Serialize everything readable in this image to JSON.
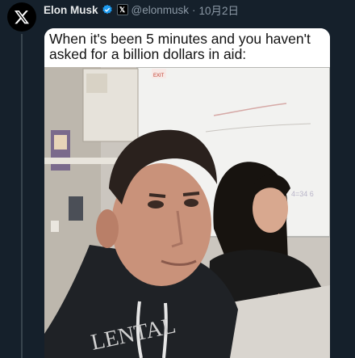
{
  "author": {
    "name": "Elon Musk",
    "handle": "@elonmusk",
    "separator": "·",
    "date": "10月2日",
    "affiliate_badge": "𝕏"
  },
  "icons": {
    "avatar": "x-logo-icon",
    "verified": "verified-badge-icon",
    "affiliate": "x-affiliate-icon"
  },
  "colors": {
    "background": "#15202b",
    "verified": "#1d9bf0",
    "secondary_text": "#8b98a5"
  },
  "media": {
    "caption": "When it's been 5 minutes and you haven't asked for a billion dollars in aid:",
    "photo_sign": "EXIT"
  }
}
